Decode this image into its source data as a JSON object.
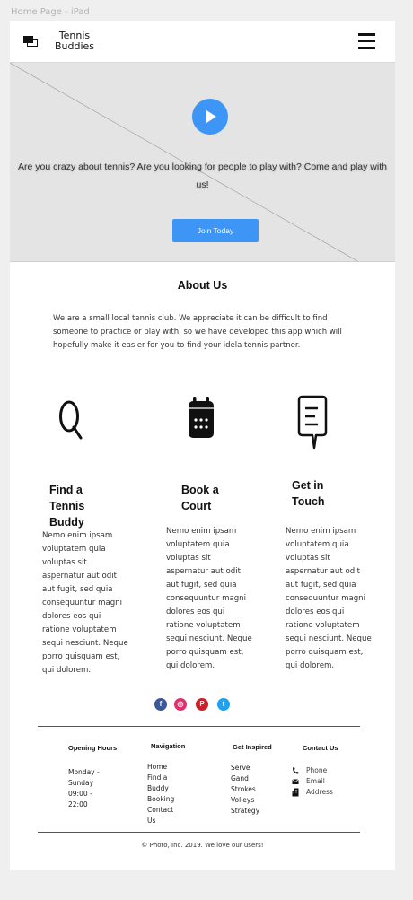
{
  "frame_label": "Home Page - iPad",
  "header": {
    "logo_line1": "Tennis",
    "logo_line2": "Buddies",
    "menu_icon": "hamburger-menu-icon"
  },
  "hero": {
    "play_icon": "play-icon",
    "text": "Are you crazy about tennis? Are you looking for people to play with? Come and play with us!",
    "cta_label": "Join Today"
  },
  "about": {
    "title": "About Us",
    "text": "We are a small local tennis club. We appreciate it can be difficult to find someone to practice or play with, so we have developed this app which will hopefully make it easier for you to find your idela tennis partner."
  },
  "features": [
    {
      "icon": "search-icon",
      "title_lines": [
        "Find a",
        "Tennis",
        "Buddy"
      ],
      "body": "Nemo enim ipsam voluptatem quia voluptas sit aspernatur aut odit aut fugit, sed quia consequuntur magni dolores eos qui ratione voluptatem sequi nesciunt. Neque porro quisquam est, qui dolorem."
    },
    {
      "icon": "calendar-icon",
      "title_lines": [
        "Book a",
        "Court"
      ],
      "body": "Nemo enim ipsam voluptatem quia voluptas sit aspernatur aut odit aut fugit, sed quia consequuntur magni dolores eos qui ratione voluptatem sequi nesciunt. Neque porro quisquam est, qui dolorem."
    },
    {
      "icon": "chat-icon",
      "title_lines": [
        "Get in",
        "Touch"
      ],
      "body": "Nemo enim ipsam voluptatem quia voluptas sit aspernatur aut odit aut fugit, sed quia consequuntur magni dolores eos qui ratione voluptatem sequi nesciunt. Neque porro quisquam est, qui dolorem."
    }
  ],
  "social": [
    {
      "icon": "facebook-icon",
      "glyph": "f",
      "color": "#3b5998"
    },
    {
      "icon": "instagram-icon",
      "glyph": "◎",
      "color": "#e1306c"
    },
    {
      "icon": "pinterest-icon",
      "glyph": "P",
      "color": "#cb2027"
    },
    {
      "icon": "twitter-icon",
      "glyph": "t",
      "color": "#1da1f2"
    }
  ],
  "footer": {
    "opening_hours": {
      "title": "Opening Hours",
      "lines": [
        "Monday -",
        "Sunday",
        "09:00 -",
        "22:00"
      ]
    },
    "navigation": {
      "title": "Navigation",
      "items": [
        "Home",
        "Find a",
        "Buddy",
        "Booking",
        "Contact",
        "Us"
      ]
    },
    "get_inspired": {
      "title": "Get Inspired",
      "items": [
        "Serve",
        "Gand",
        "Strokes",
        "Volleys",
        "Strategy"
      ]
    },
    "contact": {
      "title": "Contact Us",
      "items": [
        {
          "icon": "phone-icon",
          "label": "Phone"
        },
        {
          "icon": "email-icon",
          "label": "Email"
        },
        {
          "icon": "address-icon",
          "label": "Address"
        }
      ]
    },
    "copyright": "© Photo, Inc. 2019. We love our users!"
  },
  "colors": {
    "accent": "#3d95f5",
    "hero_bg": "#e4e4e4",
    "page_bg": "#efefef"
  }
}
